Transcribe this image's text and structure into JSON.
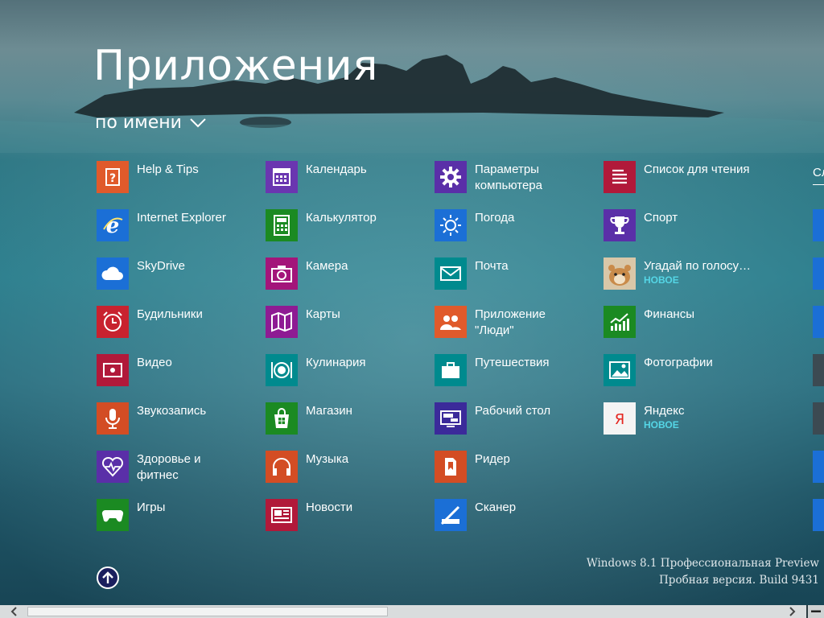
{
  "header": {
    "title": "Приложения",
    "sort_label": "по имени"
  },
  "apps": [
    {
      "name": "Help & Tips",
      "color": "#e05a2b",
      "icon": "question-icon"
    },
    {
      "name": "Internet Explorer",
      "color": "#1b6fd6",
      "icon": "ie-icon"
    },
    {
      "name": "SkyDrive",
      "color": "#1b6fd6",
      "icon": "cloud-icon"
    },
    {
      "name": "Будильники",
      "color": "#c8222f",
      "icon": "alarm-clock-icon"
    },
    {
      "name": "Видео",
      "color": "#b1193a",
      "icon": "video-icon"
    },
    {
      "name": "Звукозапись",
      "color": "#d34d24",
      "icon": "microphone-icon"
    },
    {
      "name": "Здоровье и\nфитнес",
      "color": "#5a2fa8",
      "icon": "heart-pulse-icon"
    },
    {
      "name": "Игры",
      "color": "#1b8a22",
      "icon": "gamepad-icon"
    },
    {
      "name": "Календарь",
      "color": "#6a36b0",
      "icon": "calendar-icon"
    },
    {
      "name": "Калькулятор",
      "color": "#1b8a22",
      "icon": "calculator-icon"
    },
    {
      "name": "Камера",
      "color": "#a3157a",
      "icon": "camera-icon"
    },
    {
      "name": "Карты",
      "color": "#8e1b93",
      "icon": "map-icon"
    },
    {
      "name": "Кулинария",
      "color": "#008a8e",
      "icon": "plate-icon"
    },
    {
      "name": "Магазин",
      "color": "#1b8a22",
      "icon": "store-icon"
    },
    {
      "name": "Музыка",
      "color": "#d34d24",
      "icon": "headphones-icon"
    },
    {
      "name": "Новости",
      "color": "#b1193a",
      "icon": "newspaper-icon"
    },
    {
      "name": "Параметры\nкомпьютера",
      "color": "#5a2fa8",
      "icon": "gear-icon"
    },
    {
      "name": "Погода",
      "color": "#1b6fd6",
      "icon": "sun-icon"
    },
    {
      "name": "Почта",
      "color": "#008a8e",
      "icon": "mail-icon"
    },
    {
      "name": "Приложение\n\"Люди\"",
      "color": "#e05a2b",
      "icon": "people-icon"
    },
    {
      "name": "Путешествия",
      "color": "#008a8e",
      "icon": "suitcase-icon"
    },
    {
      "name": "Рабочий стол",
      "color": "#3b2a9a",
      "icon": "desktop-icon"
    },
    {
      "name": "Ридер",
      "color": "#d34d24",
      "icon": "reader-icon"
    },
    {
      "name": "Сканер",
      "color": "#1b6fd6",
      "icon": "scanner-icon"
    },
    {
      "name": "Список для чтения",
      "color": "#b1193a",
      "icon": "reading-list-icon"
    },
    {
      "name": "Спорт",
      "color": "#5a2fa8",
      "icon": "trophy-icon"
    },
    {
      "name": "Угадай по голосу…",
      "color": "#c9b79a",
      "icon": "hamster-icon",
      "badge": "НОВОЕ"
    },
    {
      "name": "Финансы",
      "color": "#1b8a22",
      "icon": "finance-chart-icon"
    },
    {
      "name": "Фотографии",
      "color": "#008a8e",
      "icon": "photo-icon"
    },
    {
      "name": "Яндекс",
      "color": "#f4f4f4",
      "icon": "yandex-icon",
      "badge": "НОВОЕ"
    }
  ],
  "next_group_header": "Сл",
  "watermark": {
    "line1": "Windows 8.1 Профессиональная Preview",
    "line2": "Пробная версия. Build 9431"
  },
  "scrollbar": {
    "position_fraction": 0.0,
    "visible_fraction": 0.48
  }
}
